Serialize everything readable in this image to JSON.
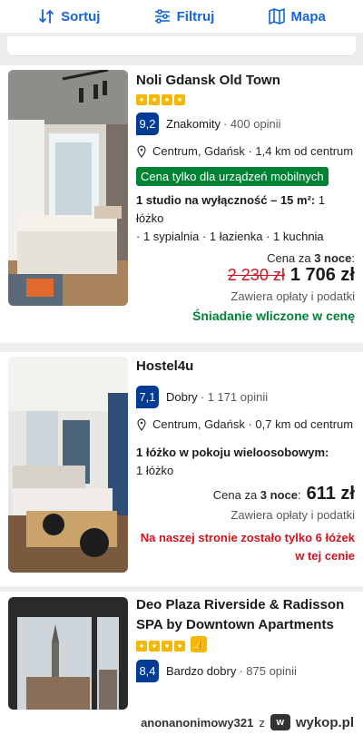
{
  "toolbar": {
    "sort_label": "Sortuj",
    "filter_label": "Filtruj",
    "map_label": "Mapa",
    "accent": "#1565d8"
  },
  "listings": [
    {
      "name": "Noli Gdansk Old Town",
      "stars": 4,
      "score": "9,2",
      "rating_label": "Znakomity",
      "reviews": "· 400 opinii",
      "location": "Centrum, Gdańsk · 1,4 km od centrum",
      "badge": "Cena tylko dla urządzeń mobilnych",
      "room_title": "1 studio na wyłączność – 15 m²:",
      "room_details_1": " 1 łóżko",
      "room_details_2": "· 1 sypialnia · 1 łazienka · 1 kuchnia",
      "nights_prefix": "Cena za ",
      "nights_bold": "3 noce",
      "nights_suffix": ":",
      "old_price": "2 230 zł",
      "price": "1 706 zł",
      "taxes": "Zawiera opłaty i podatki",
      "breakfast": "Śniadanie wliczone w cenę"
    },
    {
      "name": "Hostel4u",
      "score": "7,1",
      "rating_label": "Dobry",
      "reviews": "· 1 171 opinii",
      "location": "Centrum, Gdańsk · 0,7 km od centrum",
      "room_title": "1 łóżko w pokoju wieloosobowym:",
      "room_details_1": "1 łóżko",
      "nights_prefix": "Cena za ",
      "nights_bold": "3 noce",
      "nights_suffix": ":",
      "price": "611 zł",
      "taxes": "Zawiera opłaty i podatki",
      "scarcity_1": "Na naszej stronie zostało tylko 6 łóżek",
      "scarcity_2": "w tej cenie"
    },
    {
      "name_1": "Deo Plaza Riverside & Radisson",
      "name_2": "SPA by Downtown Apartments",
      "stars": 4,
      "score": "8,4",
      "rating_label": "Bardzo dobry",
      "reviews": "· 875 opinii"
    }
  ],
  "footer": {
    "user": "anonanonimowy321",
    "via": "z",
    "site": "wykop.pl",
    "logo_text": "w"
  },
  "colors": {
    "score_bg": "#003b95",
    "green": "#008234",
    "red": "#d4111e",
    "star": "#f5b800"
  }
}
